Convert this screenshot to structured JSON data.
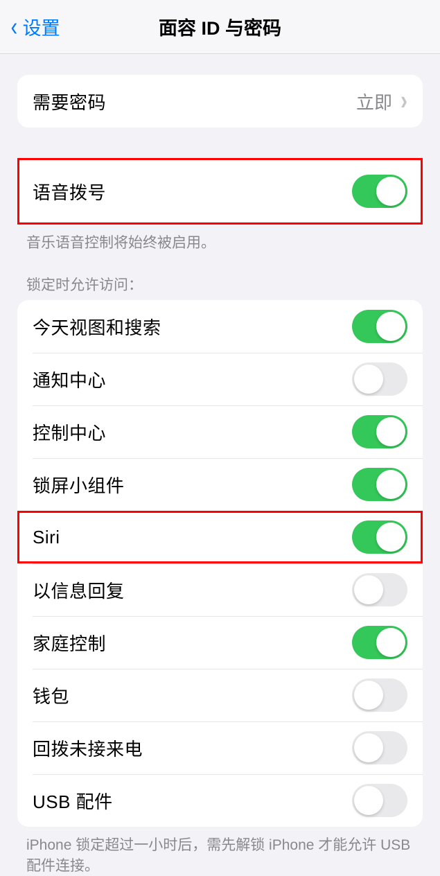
{
  "nav": {
    "back_label": "设置",
    "title": "面容 ID 与密码"
  },
  "passcode_group": {
    "require_passcode": {
      "label": "需要密码",
      "value": "立即"
    }
  },
  "voice_dial": {
    "label": "语音拨号",
    "on": true,
    "footer": "音乐语音控制将始终被启用。"
  },
  "lock_access": {
    "header": "锁定时允许访问：",
    "items": [
      {
        "label": "今天视图和搜索",
        "on": true
      },
      {
        "label": "通知中心",
        "on": false
      },
      {
        "label": "控制中心",
        "on": true
      },
      {
        "label": "锁屏小组件",
        "on": true
      },
      {
        "label": "Siri",
        "on": true
      },
      {
        "label": "以信息回复",
        "on": false
      },
      {
        "label": "家庭控制",
        "on": true
      },
      {
        "label": "钱包",
        "on": false
      },
      {
        "label": "回拨未接来电",
        "on": false
      },
      {
        "label": "USB 配件",
        "on": false
      }
    ],
    "footer": "iPhone 锁定超过一小时后，需先解锁 iPhone 才能允许 USB 配件连接。"
  }
}
